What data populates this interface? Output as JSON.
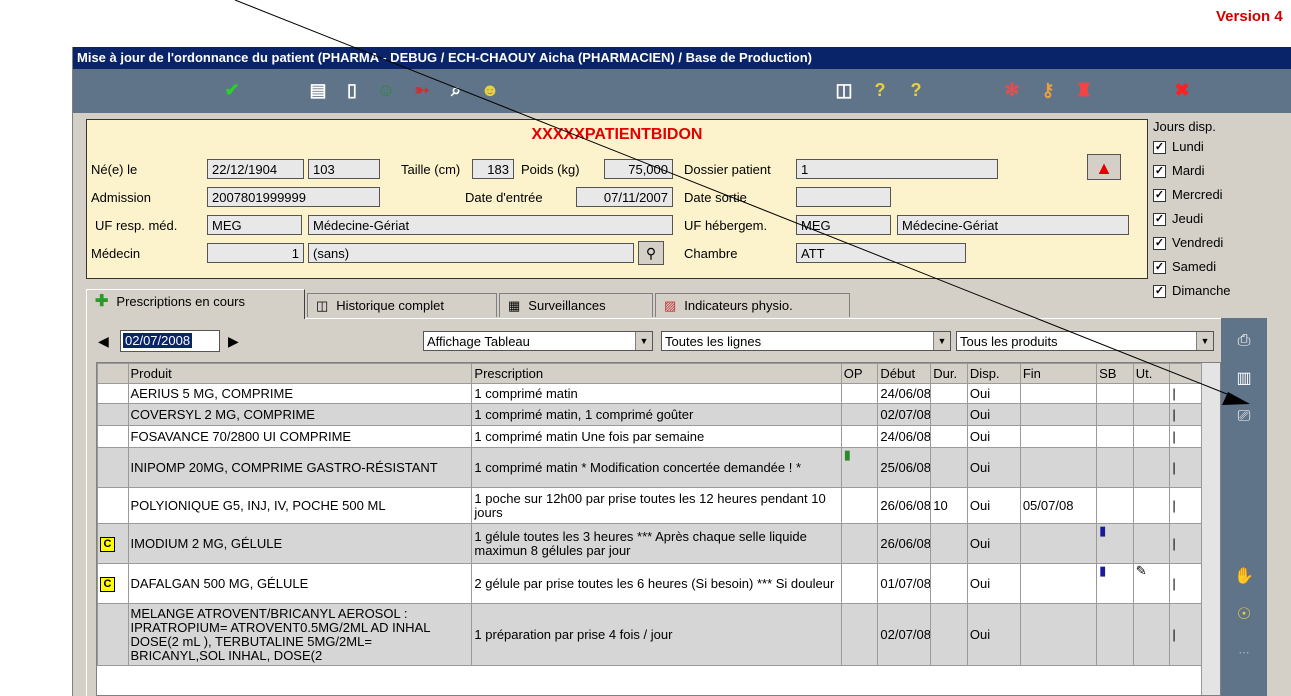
{
  "version_text": "Version 4",
  "window": {
    "title": "Mise à jour de l'ordonnance du patient (PHARMA - DEBUG / ECH-CHAOUY Aicha (PHARMACIEN) / Base de Production)"
  },
  "toolbar": {
    "icons": [
      "validate-check-icon",
      "print-doc-icon",
      "notebook-icon",
      "users-icon",
      "pill-transfer-icon",
      "image-search-icon",
      "people-chat-icon",
      "book-icon",
      "help-icon",
      "help-plus-icon",
      "molecules-icon",
      "user-key-icon",
      "user-lock-icon",
      "close-x-icon"
    ]
  },
  "patient": {
    "name": "XXXXXPATIENTBIDON",
    "labels": {
      "ne_le": "Né(e) le",
      "taille": "Taille (cm)",
      "poids": "Poids (kg)",
      "dossier": "Dossier patient",
      "admission": "Admission",
      "date_entree": "Date d'entrée",
      "date_sortie": "Date sortie",
      "uf_resp": "UF resp. méd.",
      "uf_heberg": "UF hébergem.",
      "medecin": "Médecin",
      "chambre": "Chambre"
    },
    "values": {
      "birth_date": "22/12/1904",
      "age": "103",
      "taille": "183",
      "poids": "75,000",
      "dossier": "1",
      "admission": "2007801999999",
      "date_entree": "07/11/2007",
      "date_sortie": "",
      "uf_resp_code": "MEG",
      "uf_resp_label": "Médecine-Gériat",
      "uf_heberg_code": "MEG",
      "uf_heberg_label": "Médecine-Gériat",
      "medecin_num": "1",
      "medecin_name": "(sans)",
      "chambre": "ATT"
    }
  },
  "jours": {
    "title": "Jours disp.",
    "days": [
      {
        "label": "Lundi",
        "checked": true
      },
      {
        "label": "Mardi",
        "checked": true
      },
      {
        "label": "Mercredi",
        "checked": true
      },
      {
        "label": "Jeudi",
        "checked": true
      },
      {
        "label": "Vendredi",
        "checked": true
      },
      {
        "label": "Samedi",
        "checked": true
      },
      {
        "label": "Dimanche",
        "checked": true
      }
    ]
  },
  "tabs": [
    {
      "label": "Prescriptions en cours",
      "icon": "green-cross-icon"
    },
    {
      "label": "Historique complet",
      "icon": "book-icon"
    },
    {
      "label": "Surveillances",
      "icon": "table-icon"
    },
    {
      "label": "Indicateurs physio.",
      "icon": "chart-icon"
    }
  ],
  "filters": {
    "date": "02/07/2008",
    "affichage": "Affichage Tableau",
    "lignes": "Toutes les lignes",
    "produits": "Tous les produits"
  },
  "table": {
    "columns": [
      "Produit",
      "Prescription",
      "OP",
      "Début",
      "Dur.",
      "Disp.",
      "Fin",
      "SB",
      "Ut."
    ],
    "rows": [
      {
        "badge": "",
        "produit": "AERIUS 5 MG, COMPRIME",
        "prescription": "1 comprimé matin",
        "op": "",
        "debut": "24/06/08",
        "dur": "",
        "disp": "Oui",
        "fin": "",
        "sb": "",
        "ut": ""
      },
      {
        "badge": "",
        "produit": "COVERSYL 2 MG,  COMPRIME",
        "prescription": "1 comprimé matin, 1 comprimé goûter",
        "op": "",
        "debut": "02/07/08",
        "dur": "",
        "disp": "Oui",
        "fin": "",
        "sb": "",
        "ut": ""
      },
      {
        "badge": "",
        "produit": "FOSAVANCE 70/2800 UI COMPRIME",
        "prescription": "1 comprimé matin  Une fois par semaine",
        "op": "",
        "debut": "24/06/08",
        "dur": "",
        "disp": "Oui",
        "fin": "",
        "sb": "",
        "ut": ""
      },
      {
        "badge": "",
        "produit": "INIPOMP 20MG, COMPRIME GASTRO-RÉSISTANT",
        "prescription": "1 comprimé matin  * Modification concertée demandée ! *",
        "op": "note",
        "debut": "25/06/08",
        "dur": "",
        "disp": "Oui",
        "fin": "",
        "sb": "",
        "ut": ""
      },
      {
        "badge": "",
        "produit": "POLYIONIQUE G5, INJ,  IV, POCHE 500 ML",
        "prescription": "1 poche sur 12h00  par prise toutes les 12 heures pendant 10 jours",
        "op": "",
        "debut": "26/06/08",
        "dur": "10",
        "disp": "Oui",
        "fin": "05/07/08",
        "sb": "",
        "ut": ""
      },
      {
        "badge": "C",
        "produit": "IMODIUM 2 MG, GÉLULE",
        "prescription": "1 gélule toutes les 3 heures  *** Après chaque selle liquide maximun 8 gélules par jour",
        "op": "",
        "debut": "26/06/08",
        "dur": "",
        "disp": "Oui",
        "fin": "",
        "sb": "note",
        "ut": ""
      },
      {
        "badge": "C",
        "produit": "DAFALGAN 500 MG, GÉLULE",
        "prescription": "2 gélule  par prise toutes les 6 heures (Si besoin) *** Si douleur",
        "op": "",
        "debut": "01/07/08",
        "dur": "",
        "disp": "Oui",
        "fin": "",
        "sb": "note",
        "ut": "pen"
      },
      {
        "badge": "",
        "produit": "MELANGE ATROVENT/BRICANYL AEROSOL : IPRATROPIUM= ATROVENT0.5MG/2ML AD INHAL DOSE(2 mL ), TERBUTALINE 5MG/2ML= BRICANYL,SOL INHAL, DOSE(2",
        "prescription": "1 préparation par prise  4 fois / jour",
        "op": "",
        "debut": "02/07/08",
        "dur": "",
        "disp": "Oui",
        "fin": "",
        "sb": "",
        "ut": ""
      }
    ]
  },
  "colors": {
    "titlebar": "#0a246a",
    "toolbar": "#5f7389",
    "patient_bg": "#fcf2cc",
    "patient_name": "#e00000",
    "version": "#d40000"
  }
}
